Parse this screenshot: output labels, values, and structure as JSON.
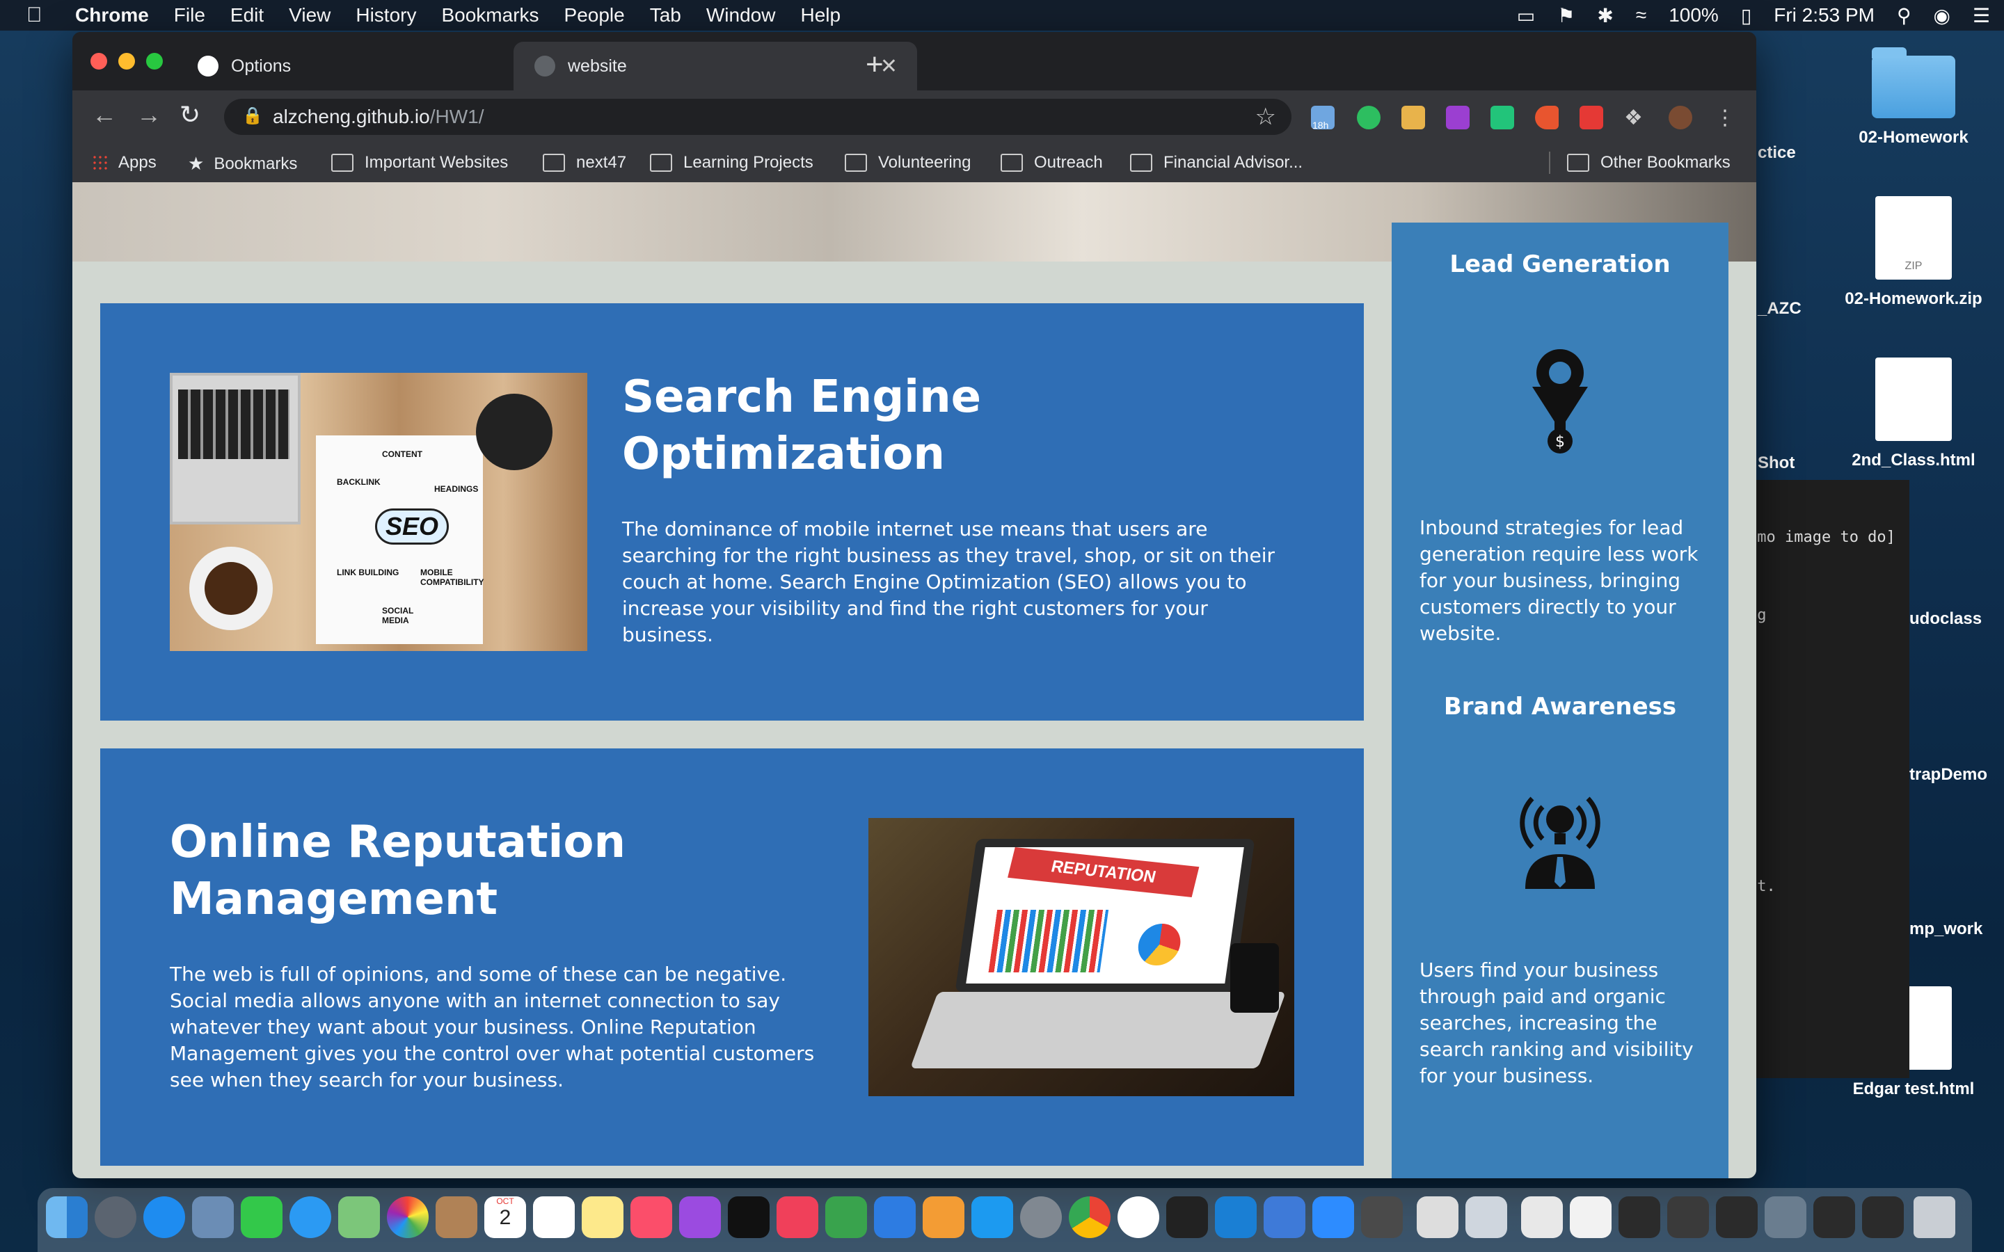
{
  "menubar": {
    "app": "Chrome",
    "items": [
      "File",
      "Edit",
      "View",
      "History",
      "Bookmarks",
      "People",
      "Tab",
      "Window",
      "Help"
    ],
    "battery": "100%",
    "clock": "Fri 2:53 PM"
  },
  "browser": {
    "tabs": [
      {
        "title": "Options"
      },
      {
        "title": "website"
      }
    ],
    "url_host": "alzcheng.github.io",
    "url_path": "/HW1/",
    "bookmarks": [
      "Apps",
      "Bookmarks",
      "Important Websites",
      "next47",
      "Learning Projects",
      "Volunteering",
      "Outreach",
      "Financial Advisor...",
      "Other Bookmarks"
    ],
    "extension_badge": "18h"
  },
  "content": {
    "seo": {
      "title_line1": "Search Engine",
      "title_line2": "Optimization",
      "body": "The dominance of mobile internet use means that users are searching for the right business as they travel, shop, or sit on their couch at home. Search Engine Optimization (SEO) allows you to increase your visibility and find the right customers for your business.",
      "image_words": [
        "CONTENT",
        "BACKLINK",
        "HEADINGS",
        "SEO",
        "LINK BUILDING",
        "MOBILE COMPATIBILITY",
        "SOCIAL MEDIA"
      ]
    },
    "orm": {
      "title_line1": "Online Reputation",
      "title_line2": "Management",
      "body": "The web is full of opinions, and some of these can be negative. Social media allows anyone with an internet connection to say whatever they want about your business. Online Reputation Management gives you the control over what potential customers see when they search for your business.",
      "image_word": "REPUTATION"
    },
    "sidebar": {
      "lead_title": "Lead Generation",
      "lead_body": "Inbound strategies for lead generation require less work for your business, bringing customers directly to your website.",
      "brand_title": "Brand Awareness",
      "brand_body": "Users find your business through paid and organic searches, increasing the search ranking and visibility for your business."
    }
  },
  "desktop": {
    "icons": [
      {
        "label": "02-Homework"
      },
      {
        "label": "02-Homework.zip",
        "badge": "ZIP"
      },
      {
        "label": "2nd_Class.html"
      },
      {
        "label": "Edgar test.html"
      }
    ],
    "partial_labels": [
      "ctice",
      "_AZC",
      "Shot",
      "udoclass",
      "trapDemo",
      "mp_work"
    ],
    "terminal_lines": [
      "emo image to do]",
      "ng",
      "ct."
    ]
  },
  "dock": {
    "calendar_month": "OCT",
    "calendar_day": "2"
  }
}
